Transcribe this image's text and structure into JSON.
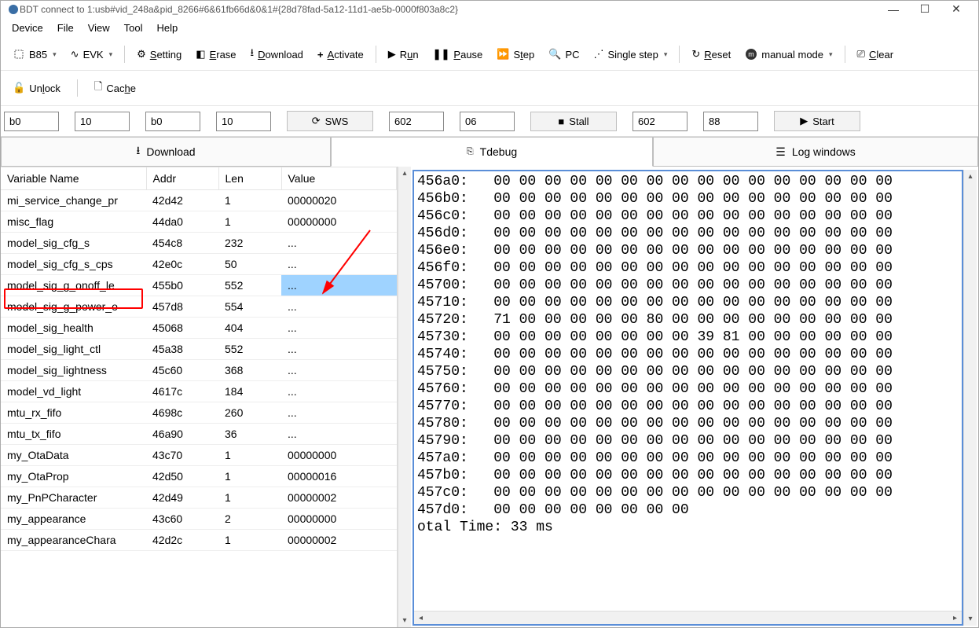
{
  "title": "BDT connect to 1:usb#vid_248a&pid_8266#6&61fb66d&0&1#{28d78fad-5a12-11d1-ae5b-0000f803a8c2}",
  "menu": [
    "Device",
    "File",
    "View",
    "Tool",
    "Help"
  ],
  "tb1": {
    "chip": "B85",
    "evk": "EVK",
    "setting": "Setting",
    "erase": "Erase",
    "download": "Download",
    "activate": "Activate",
    "run": "Run",
    "pause": "Pause",
    "step": "Step",
    "pc": "PC",
    "single_step": "Single step",
    "reset": "Reset",
    "manual_mode": "manual mode",
    "clear": "Clear"
  },
  "tb2": {
    "unlock": "Unlock",
    "cache": "Cache"
  },
  "inputs": {
    "a1": "b0",
    "a2": "10",
    "a3": "b0",
    "a4": "10",
    "sws": "SWS",
    "b1": "602",
    "b2": "06",
    "stall": "Stall",
    "c1": "602",
    "c2": "88",
    "start": "Start"
  },
  "tabs": {
    "download": "Download",
    "tdebug": "Tdebug",
    "log": "Log windows"
  },
  "cols": {
    "name": "Variable Name",
    "addr": "Addr",
    "len": "Len",
    "value": "Value"
  },
  "rows": [
    {
      "name": "mi_service_change_pr",
      "addr": "42d42",
      "len": "1",
      "val": "00000020",
      "sel": false
    },
    {
      "name": "misc_flag",
      "addr": "44da0",
      "len": "1",
      "val": "00000000",
      "sel": false
    },
    {
      "name": "model_sig_cfg_s",
      "addr": "454c8",
      "len": "232",
      "val": "...",
      "sel": false
    },
    {
      "name": "model_sig_cfg_s_cps",
      "addr": "42e0c",
      "len": "50",
      "val": "...",
      "sel": false
    },
    {
      "name": "model_sig_g_onoff_le",
      "addr": "455b0",
      "len": "552",
      "val": "...",
      "sel": true
    },
    {
      "name": "model_sig_g_power_o",
      "addr": "457d8",
      "len": "554",
      "val": "...",
      "sel": false
    },
    {
      "name": "model_sig_health",
      "addr": "45068",
      "len": "404",
      "val": "...",
      "sel": false
    },
    {
      "name": "model_sig_light_ctl",
      "addr": "45a38",
      "len": "552",
      "val": "...",
      "sel": false
    },
    {
      "name": "model_sig_lightness",
      "addr": "45c60",
      "len": "368",
      "val": "...",
      "sel": false
    },
    {
      "name": "model_vd_light",
      "addr": "4617c",
      "len": "184",
      "val": "...",
      "sel": false
    },
    {
      "name": "mtu_rx_fifo",
      "addr": "4698c",
      "len": "260",
      "val": "...",
      "sel": false
    },
    {
      "name": "mtu_tx_fifo",
      "addr": "46a90",
      "len": "36",
      "val": "...",
      "sel": false
    },
    {
      "name": "my_OtaData",
      "addr": "43c70",
      "len": "1",
      "val": "00000000",
      "sel": false
    },
    {
      "name": "my_OtaProp",
      "addr": "42d50",
      "len": "1",
      "val": "00000016",
      "sel": false
    },
    {
      "name": "my_PnPCharacter",
      "addr": "42d49",
      "len": "1",
      "val": "00000002",
      "sel": false
    },
    {
      "name": "my_appearance",
      "addr": "43c60",
      "len": "2",
      "val": "00000000",
      "sel": false
    },
    {
      "name": "my_appearanceChara",
      "addr": "42d2c",
      "len": "1",
      "val": "00000002",
      "sel": false
    }
  ],
  "hex": {
    "zero16": "00 00 00 00 00 00 00 00 00 00 00 00 00 00 00 00",
    "lines": [
      {
        "a": "456a0:",
        "d": "00 00 00 00 00 00 00 00 00 00 00 00 00 00 00 00"
      },
      {
        "a": "456b0:",
        "d": "00 00 00 00 00 00 00 00 00 00 00 00 00 00 00 00"
      },
      {
        "a": "456c0:",
        "d": "00 00 00 00 00 00 00 00 00 00 00 00 00 00 00 00"
      },
      {
        "a": "456d0:",
        "d": "00 00 00 00 00 00 00 00 00 00 00 00 00 00 00 00"
      },
      {
        "a": "456e0:",
        "d": "00 00 00 00 00 00 00 00 00 00 00 00 00 00 00 00"
      },
      {
        "a": "456f0:",
        "d": "00 00 00 00 00 00 00 00 00 00 00 00 00 00 00 00"
      },
      {
        "a": "45700:",
        "d": "00 00 00 00 00 00 00 00 00 00 00 00 00 00 00 00"
      },
      {
        "a": "45710:",
        "d": "00 00 00 00 00 00 00 00 00 00 00 00 00 00 00 00"
      },
      {
        "a": "45720:",
        "d": "71 00 00 00 00 00 80 00 00 00 00 00 00 00 00 00"
      },
      {
        "a": "45730:",
        "d": "00 00 00 00 00 00 00 00 39 81 00 00 00 00 00 00"
      },
      {
        "a": "45740:",
        "d": "00 00 00 00 00 00 00 00 00 00 00 00 00 00 00 00"
      },
      {
        "a": "45750:",
        "d": "00 00 00 00 00 00 00 00 00 00 00 00 00 00 00 00"
      },
      {
        "a": "45760:",
        "d": "00 00 00 00 00 00 00 00 00 00 00 00 00 00 00 00"
      },
      {
        "a": "45770:",
        "d": "00 00 00 00 00 00 00 00 00 00 00 00 00 00 00 00"
      },
      {
        "a": "45780:",
        "d": "00 00 00 00 00 00 00 00 00 00 00 00 00 00 00 00"
      },
      {
        "a": "45790:",
        "d": "00 00 00 00 00 00 00 00 00 00 00 00 00 00 00 00"
      },
      {
        "a": "457a0:",
        "d": "00 00 00 00 00 00 00 00 00 00 00 00 00 00 00 00"
      },
      {
        "a": "457b0:",
        "d": "00 00 00 00 00 00 00 00 00 00 00 00 00 00 00 00"
      },
      {
        "a": "457c0:",
        "d": "00 00 00 00 00 00 00 00 00 00 00 00 00 00 00 00"
      },
      {
        "a": "457d0:",
        "d": "00 00 00 00 00 00 00 00"
      }
    ],
    "footer": "otal Time: 33 ms"
  }
}
